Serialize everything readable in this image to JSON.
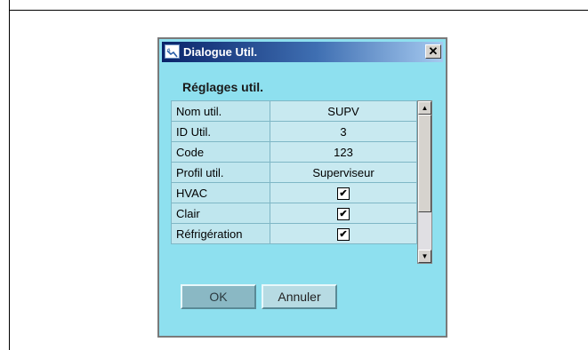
{
  "dialog": {
    "title": "Dialogue Util.",
    "close_symbol": "✕",
    "section_title": "Réglages util.",
    "rows": [
      {
        "label": "Nom util.",
        "value": "SUPV"
      },
      {
        "label": "ID Util.",
        "value": "3"
      },
      {
        "label": "Code",
        "value": "123"
      },
      {
        "label": "Profil util.",
        "value": "Superviseur"
      },
      {
        "label": "HVAC",
        "value": "✔"
      },
      {
        "label": "Clair",
        "value": "✔"
      },
      {
        "label": "Réfrigération",
        "value": "✔"
      }
    ],
    "scroll_up": "▲",
    "scroll_down": "▼",
    "ok_label": "OK",
    "cancel_label": "Annuler"
  }
}
